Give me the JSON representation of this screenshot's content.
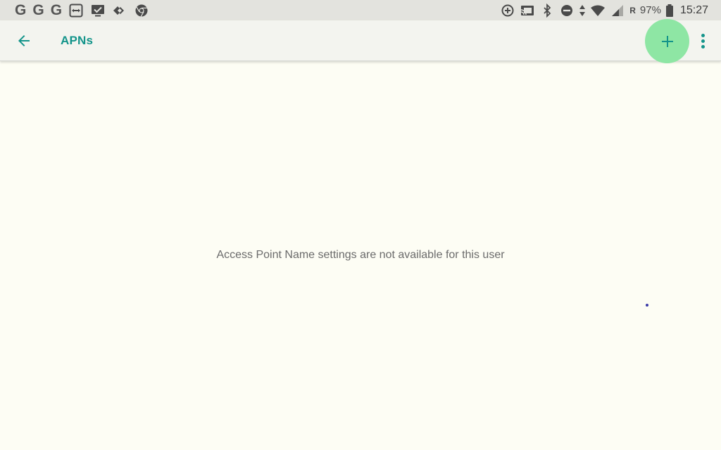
{
  "status_bar": {
    "notification_letters": [
      "G",
      "G",
      "G"
    ],
    "notification_icons": [
      "teamviewer-icon",
      "screen-check-icon",
      "tag-arrow-icon",
      "chrome-icon"
    ],
    "system_icons": [
      "data-saver-icon",
      "cast-icon",
      "bluetooth-icon",
      "do-not-disturb-icon",
      "data-arrows-icon",
      "wifi-icon",
      "signal-icon"
    ],
    "roaming": "R",
    "battery": "97%",
    "time": "15:27"
  },
  "app_bar": {
    "title": "APNs",
    "back_icon": "arrow-back-icon",
    "add_icon": "plus-icon",
    "more_icon": "more-vert-icon"
  },
  "content": {
    "empty_message": "Access Point Name settings are not available for this user"
  },
  "colors": {
    "accent": "#13948a",
    "add_button_bg": "#8ee6a4",
    "background": "#fdfdf4",
    "app_bar": "#f3f4ef",
    "status_bar": "#e3e3de"
  }
}
